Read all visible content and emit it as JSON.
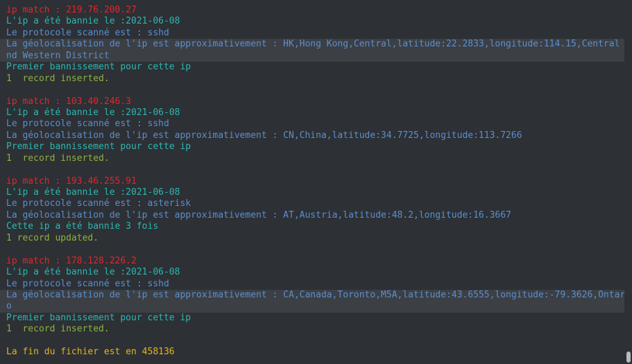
{
  "terminal": {
    "lines": [
      {
        "text": "ip match : 219.76.200.27",
        "color": "#e3262a"
      },
      {
        "text": "L'ip a été bannie le :2021-06-08",
        "color": "#2bb8b0"
      },
      {
        "text": "Le protocole scanné est : sshd",
        "color": "#5a8fd0"
      },
      {
        "text": "La géolocalisation de l'ip est approximativement : HK,Hong Kong,Central,latitude:22.2833,longitude:114.15,Central a",
        "color": "#5a8fd0"
      },
      {
        "text": "nd Western District",
        "color": "#5a8fd0"
      },
      {
        "text": "Premier bannissement pour cette ip",
        "color": "#2bb8b0"
      },
      {
        "text": "1  record inserted.",
        "color": "#8cb43c"
      },
      {
        "text": "",
        "color": ""
      },
      {
        "text": "ip match : 103.40.246.3",
        "color": "#e3262a"
      },
      {
        "text": "L'ip a été bannie le :2021-06-08",
        "color": "#2bb8b0"
      },
      {
        "text": "Le protocole scanné est : sshd",
        "color": "#5a8fd0"
      },
      {
        "text": "La géolocalisation de l'ip est approximativement : CN,China,latitude:34.7725,longitude:113.7266",
        "color": "#5a8fd0"
      },
      {
        "text": "Premier bannissement pour cette ip",
        "color": "#2bb8b0"
      },
      {
        "text": "1  record inserted.",
        "color": "#8cb43c"
      },
      {
        "text": "",
        "color": ""
      },
      {
        "text": "ip match : 193.46.255.91",
        "color": "#e3262a"
      },
      {
        "text": "L'ip a été bannie le :2021-06-08",
        "color": "#2bb8b0"
      },
      {
        "text": "Le protocole scanné est : asterisk",
        "color": "#5a8fd0"
      },
      {
        "text": "La géolocalisation de l'ip est approximativement : AT,Austria,latitude:48.2,longitude:16.3667",
        "color": "#5a8fd0"
      },
      {
        "text": "Cette ip a été bannie 3 fois",
        "color": "#2bb8b0"
      },
      {
        "text": "1 record updated.",
        "color": "#8cb43c"
      },
      {
        "text": "",
        "color": ""
      },
      {
        "text": "ip match : 178.128.226.2",
        "color": "#e3262a"
      },
      {
        "text": "L'ip a été bannie le :2021-06-08",
        "color": "#2bb8b0"
      },
      {
        "text": "Le protocole scanné est : sshd",
        "color": "#5a8fd0"
      },
      {
        "text": "La géolocalisation de l'ip est approximativement : CA,Canada,Toronto,M5A,latitude:43.6555,longitude:-79.3626,Ontari",
        "color": "#5a8fd0"
      },
      {
        "text": "o",
        "color": "#5a8fd0"
      },
      {
        "text": "Premier bannissement pour cette ip",
        "color": "#2bb8b0"
      },
      {
        "text": "1  record inserted.",
        "color": "#8cb43c"
      },
      {
        "text": "",
        "color": ""
      },
      {
        "text": "La fin du fichier est en 458136",
        "color": "#e6b422"
      }
    ]
  }
}
